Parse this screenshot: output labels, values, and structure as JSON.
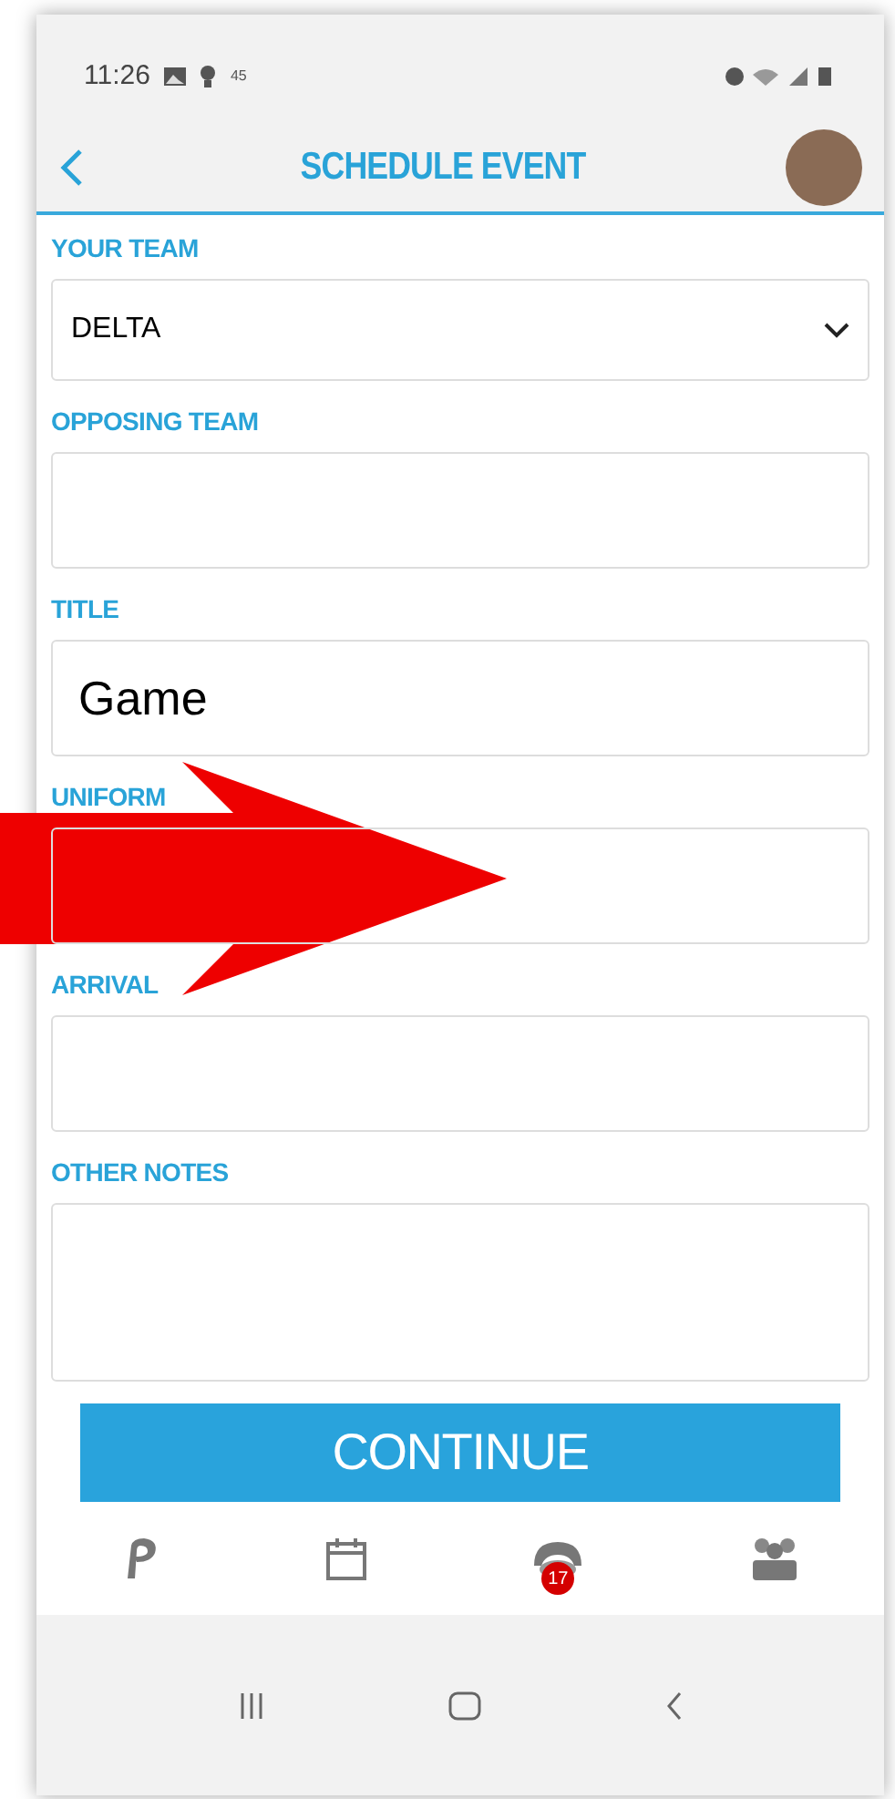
{
  "status_bar": {
    "time": "11:26",
    "temperature": "45"
  },
  "header": {
    "title": "SCHEDULE EVENT"
  },
  "fields": [
    {
      "kind": "select",
      "label": "YOUR TEAM",
      "value": "DELTA"
    },
    {
      "kind": "text",
      "label": "OPPOSING TEAM"
    },
    {
      "kind": "text",
      "label": "TITLE",
      "value": "Game"
    },
    {
      "kind": "text",
      "label": "UNIFORM"
    },
    {
      "kind": "text",
      "label": "ARRIVAL"
    },
    {
      "kind": "textarea",
      "label": "OTHER NOTES"
    }
  ],
  "continue_button": "CONTINUE",
  "bottom_nav": [
    {
      "kind": "logo"
    },
    {
      "kind": "calendar"
    },
    {
      "kind": "whistle",
      "badge": "17"
    },
    {
      "kind": "team"
    }
  ],
  "annotation": {
    "kind": "arrow",
    "color": "#ee0000"
  }
}
